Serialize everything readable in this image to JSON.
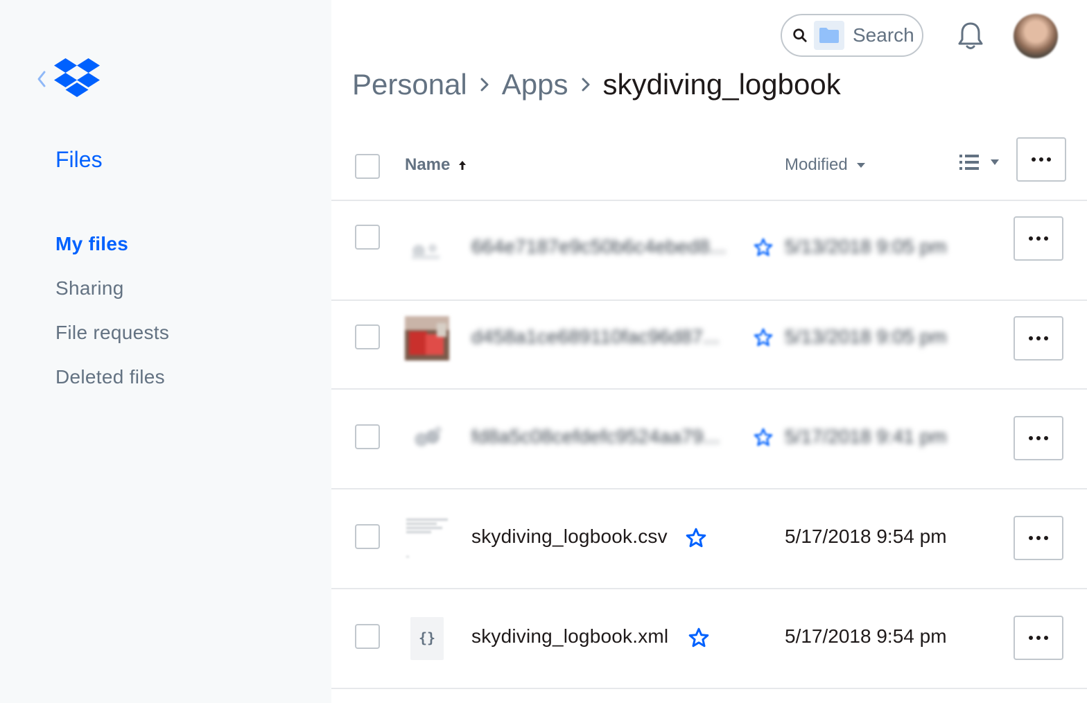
{
  "sidebar": {
    "title": "Files",
    "items": [
      {
        "label": "My files",
        "active": true
      },
      {
        "label": "Sharing",
        "active": false
      },
      {
        "label": "File requests",
        "active": false
      },
      {
        "label": "Deleted files",
        "active": false
      }
    ]
  },
  "topbar": {
    "search_placeholder": "Search"
  },
  "breadcrumb": {
    "items": [
      "Personal",
      "Apps",
      "skydiving_logbook"
    ]
  },
  "table": {
    "headers": {
      "name": "Name",
      "modified": "Modified"
    },
    "rows": [
      {
        "name": "664e7187e9c50b6c4ebed8...",
        "modified": "5/13/2018 9:05 pm",
        "thumb": "image-thumbnail",
        "blurred": true
      },
      {
        "name": "d458a1ce689110fac96d87...",
        "modified": "5/13/2018 9:05 pm",
        "thumb": "photo-thumbnail",
        "blurred": true
      },
      {
        "name": "fd8a5c08cefdefc9524aa79...",
        "modified": "5/17/2018 9:41 pm",
        "thumb": "image-thumbnail",
        "blurred": true
      },
      {
        "name": "skydiving_logbook.csv",
        "modified": "5/17/2018 9:54 pm",
        "thumb": "spreadsheet-thumbnail",
        "blurred": false
      },
      {
        "name": "skydiving_logbook.xml",
        "modified": "5/17/2018 9:54 pm",
        "thumb": "code-file-icon",
        "blurred": false
      }
    ]
  },
  "colors": {
    "accent": "#0061fe",
    "muted_text": "#637282",
    "border": "#c1c7cd",
    "sidebar_bg": "#f7f9fa"
  }
}
